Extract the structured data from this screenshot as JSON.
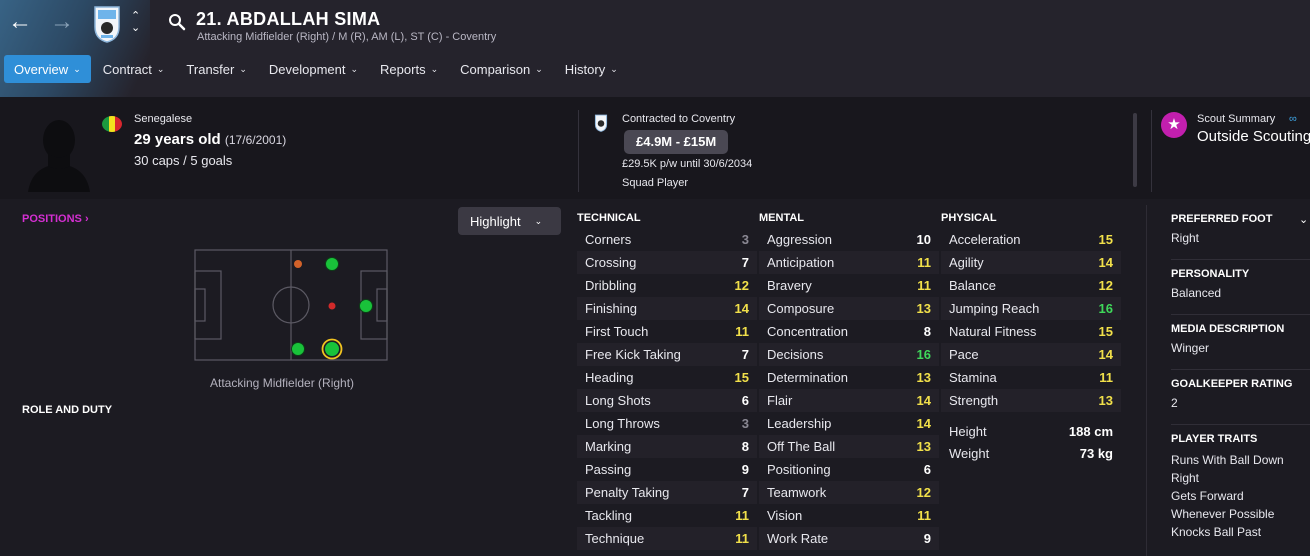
{
  "header": {
    "player_name": "21. ABDALLAH SIMA",
    "positions_line": "Attacking Midfielder (Right) / M (R), AM (L), ST (C) - Coventry"
  },
  "tabs": [
    {
      "label": "Overview",
      "active": true
    },
    {
      "label": "Contract"
    },
    {
      "label": "Transfer"
    },
    {
      "label": "Development"
    },
    {
      "label": "Reports"
    },
    {
      "label": "Comparison"
    },
    {
      "label": "History"
    }
  ],
  "bio": {
    "nationality": "Senegalese",
    "age": "29 years old",
    "dob": "(17/6/2001)",
    "caps": "30 caps / 5 goals"
  },
  "contract": {
    "label": "Contracted to Coventry",
    "value": "£4.9M - £15M",
    "wage": "£29.5K p/w until 30/6/2034",
    "status": "Squad Player"
  },
  "scout": {
    "label": "Scout Summary",
    "status": "Outside Scouting"
  },
  "positions": {
    "link": "POSITIONS",
    "highlight_label": "Highlight",
    "pitch_caption": "Attacking Midfielder (Right)",
    "role_duty": "ROLE AND DUTY"
  },
  "attributes": {
    "technical": {
      "title": "TECHNICAL",
      "rows": [
        {
          "name": "Corners",
          "value": "3"
        },
        {
          "name": "Crossing",
          "value": "7"
        },
        {
          "name": "Dribbling",
          "value": "12"
        },
        {
          "name": "Finishing",
          "value": "14"
        },
        {
          "name": "First Touch",
          "value": "11"
        },
        {
          "name": "Free Kick Taking",
          "value": "7"
        },
        {
          "name": "Heading",
          "value": "15"
        },
        {
          "name": "Long Shots",
          "value": "6"
        },
        {
          "name": "Long Throws",
          "value": "3"
        },
        {
          "name": "Marking",
          "value": "8"
        },
        {
          "name": "Passing",
          "value": "9"
        },
        {
          "name": "Penalty Taking",
          "value": "7"
        },
        {
          "name": "Tackling",
          "value": "11"
        },
        {
          "name": "Technique",
          "value": "11"
        }
      ]
    },
    "mental": {
      "title": "MENTAL",
      "rows": [
        {
          "name": "Aggression",
          "value": "10"
        },
        {
          "name": "Anticipation",
          "value": "11"
        },
        {
          "name": "Bravery",
          "value": "11"
        },
        {
          "name": "Composure",
          "value": "13"
        },
        {
          "name": "Concentration",
          "value": "8"
        },
        {
          "name": "Decisions",
          "value": "16"
        },
        {
          "name": "Determination",
          "value": "13"
        },
        {
          "name": "Flair",
          "value": "14"
        },
        {
          "name": "Leadership",
          "value": "14"
        },
        {
          "name": "Off The Ball",
          "value": "13"
        },
        {
          "name": "Positioning",
          "value": "6"
        },
        {
          "name": "Teamwork",
          "value": "12"
        },
        {
          "name": "Vision",
          "value": "11"
        },
        {
          "name": "Work Rate",
          "value": "9"
        }
      ]
    },
    "physical": {
      "title": "PHYSICAL",
      "rows": [
        {
          "name": "Acceleration",
          "value": "15"
        },
        {
          "name": "Agility",
          "value": "14"
        },
        {
          "name": "Balance",
          "value": "12"
        },
        {
          "name": "Jumping Reach",
          "value": "16"
        },
        {
          "name": "Natural Fitness",
          "value": "15"
        },
        {
          "name": "Pace",
          "value": "14"
        },
        {
          "name": "Stamina",
          "value": "11"
        },
        {
          "name": "Strength",
          "value": "13"
        }
      ],
      "height_label": "Height",
      "height": "188 cm",
      "weight_label": "Weight",
      "weight": "73 kg"
    }
  },
  "side": {
    "preferred_foot_title": "PREFERRED FOOT",
    "preferred_foot": "Right",
    "personality_title": "PERSONALITY",
    "personality": "Balanced",
    "media_title": "MEDIA DESCRIPTION",
    "media": "Winger",
    "gk_title": "GOALKEEPER RATING",
    "gk": "2",
    "traits_title": "PLAYER TRAITS",
    "traits": [
      "Runs With Ball Down",
      "Right",
      "Gets Forward",
      "Whenever Possible",
      "Knocks Ball Past"
    ]
  },
  "colors": {
    "accent": "#2f8fd8",
    "positions_link": "#d52fd2",
    "attr_good": "#f1e04a",
    "attr_great": "#3fd85a",
    "scout": "#c21fae"
  }
}
